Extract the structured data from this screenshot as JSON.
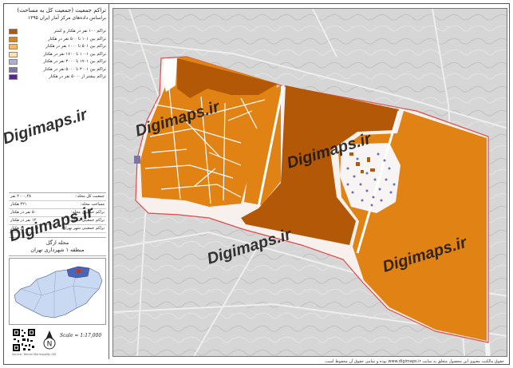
{
  "title": {
    "line1": "تراکم جمعیت (جمعیت کل به مساحت)",
    "line2": "براساس داده‌های مرکز آمار ایران ۱۳۹۵"
  },
  "legend": [
    {
      "label": "تراکم ۱۰۰ نفر در هکتار و کمتر",
      "color": "#b35806"
    },
    {
      "label": "تراکم بین ۱۰۱ تا ۵۰۰ نفر در هکتار",
      "color": "#e08214"
    },
    {
      "label": "تراکم بین ۵۰۱ تا ۱۰۰۰ نفر در هکتار",
      "color": "#fdb863"
    },
    {
      "label": "تراکم بین ۱۰۰۱ تا ۱۷۰۰ نفر در هکتار",
      "color": "#fee0b6"
    },
    {
      "label": "تراکم بین ۱۷۰۱ تا ۳۰۰۰ نفر در هکتار",
      "color": "#b2abd2"
    },
    {
      "label": "تراکم بین ۳۰۰۱ تا ۵۰۰۰ نفر در هکتار",
      "color": "#8073ac"
    },
    {
      "label": "تراکم بیشتر از ۵۰۰۰ نفر در هکتار",
      "color": "#542788"
    }
  ],
  "stats": [
    {
      "label": "جمعیت کل محله:",
      "value": "۲۰۰۰,۴۸ نفر"
    },
    {
      "label": "مساحت محله:",
      "value": "۴۲۱ هکتار"
    },
    {
      "label": "تراکم جمعیتی محله:",
      "value": "۵۰ نفر در هکتار"
    },
    {
      "label": "تراکم جمعیتی منطقه ۱:",
      "value": "۱۲ نفر در هکتار"
    },
    {
      "label": "تراکم جمعیتی شهر تهران:",
      "value": "۱۰۵ نفر در هکتار"
    }
  ],
  "region": {
    "line1": "محله ازگل",
    "line2": "منطقه ۱ شهرداری تهران"
  },
  "scale": "Scale = 1:17,000",
  "credit": "Source: Tehran Municipality GIS",
  "footer": "حقوق مالکیت معنوی این محصول متعلق به سایت www.digimaps.ir بوده و تمامی حقوق آن محفوظ است.",
  "watermark": "Digimaps.ir",
  "colors": {
    "class1": "#b35806",
    "class2": "#e08214",
    "basemap": "#d9d9d9"
  }
}
